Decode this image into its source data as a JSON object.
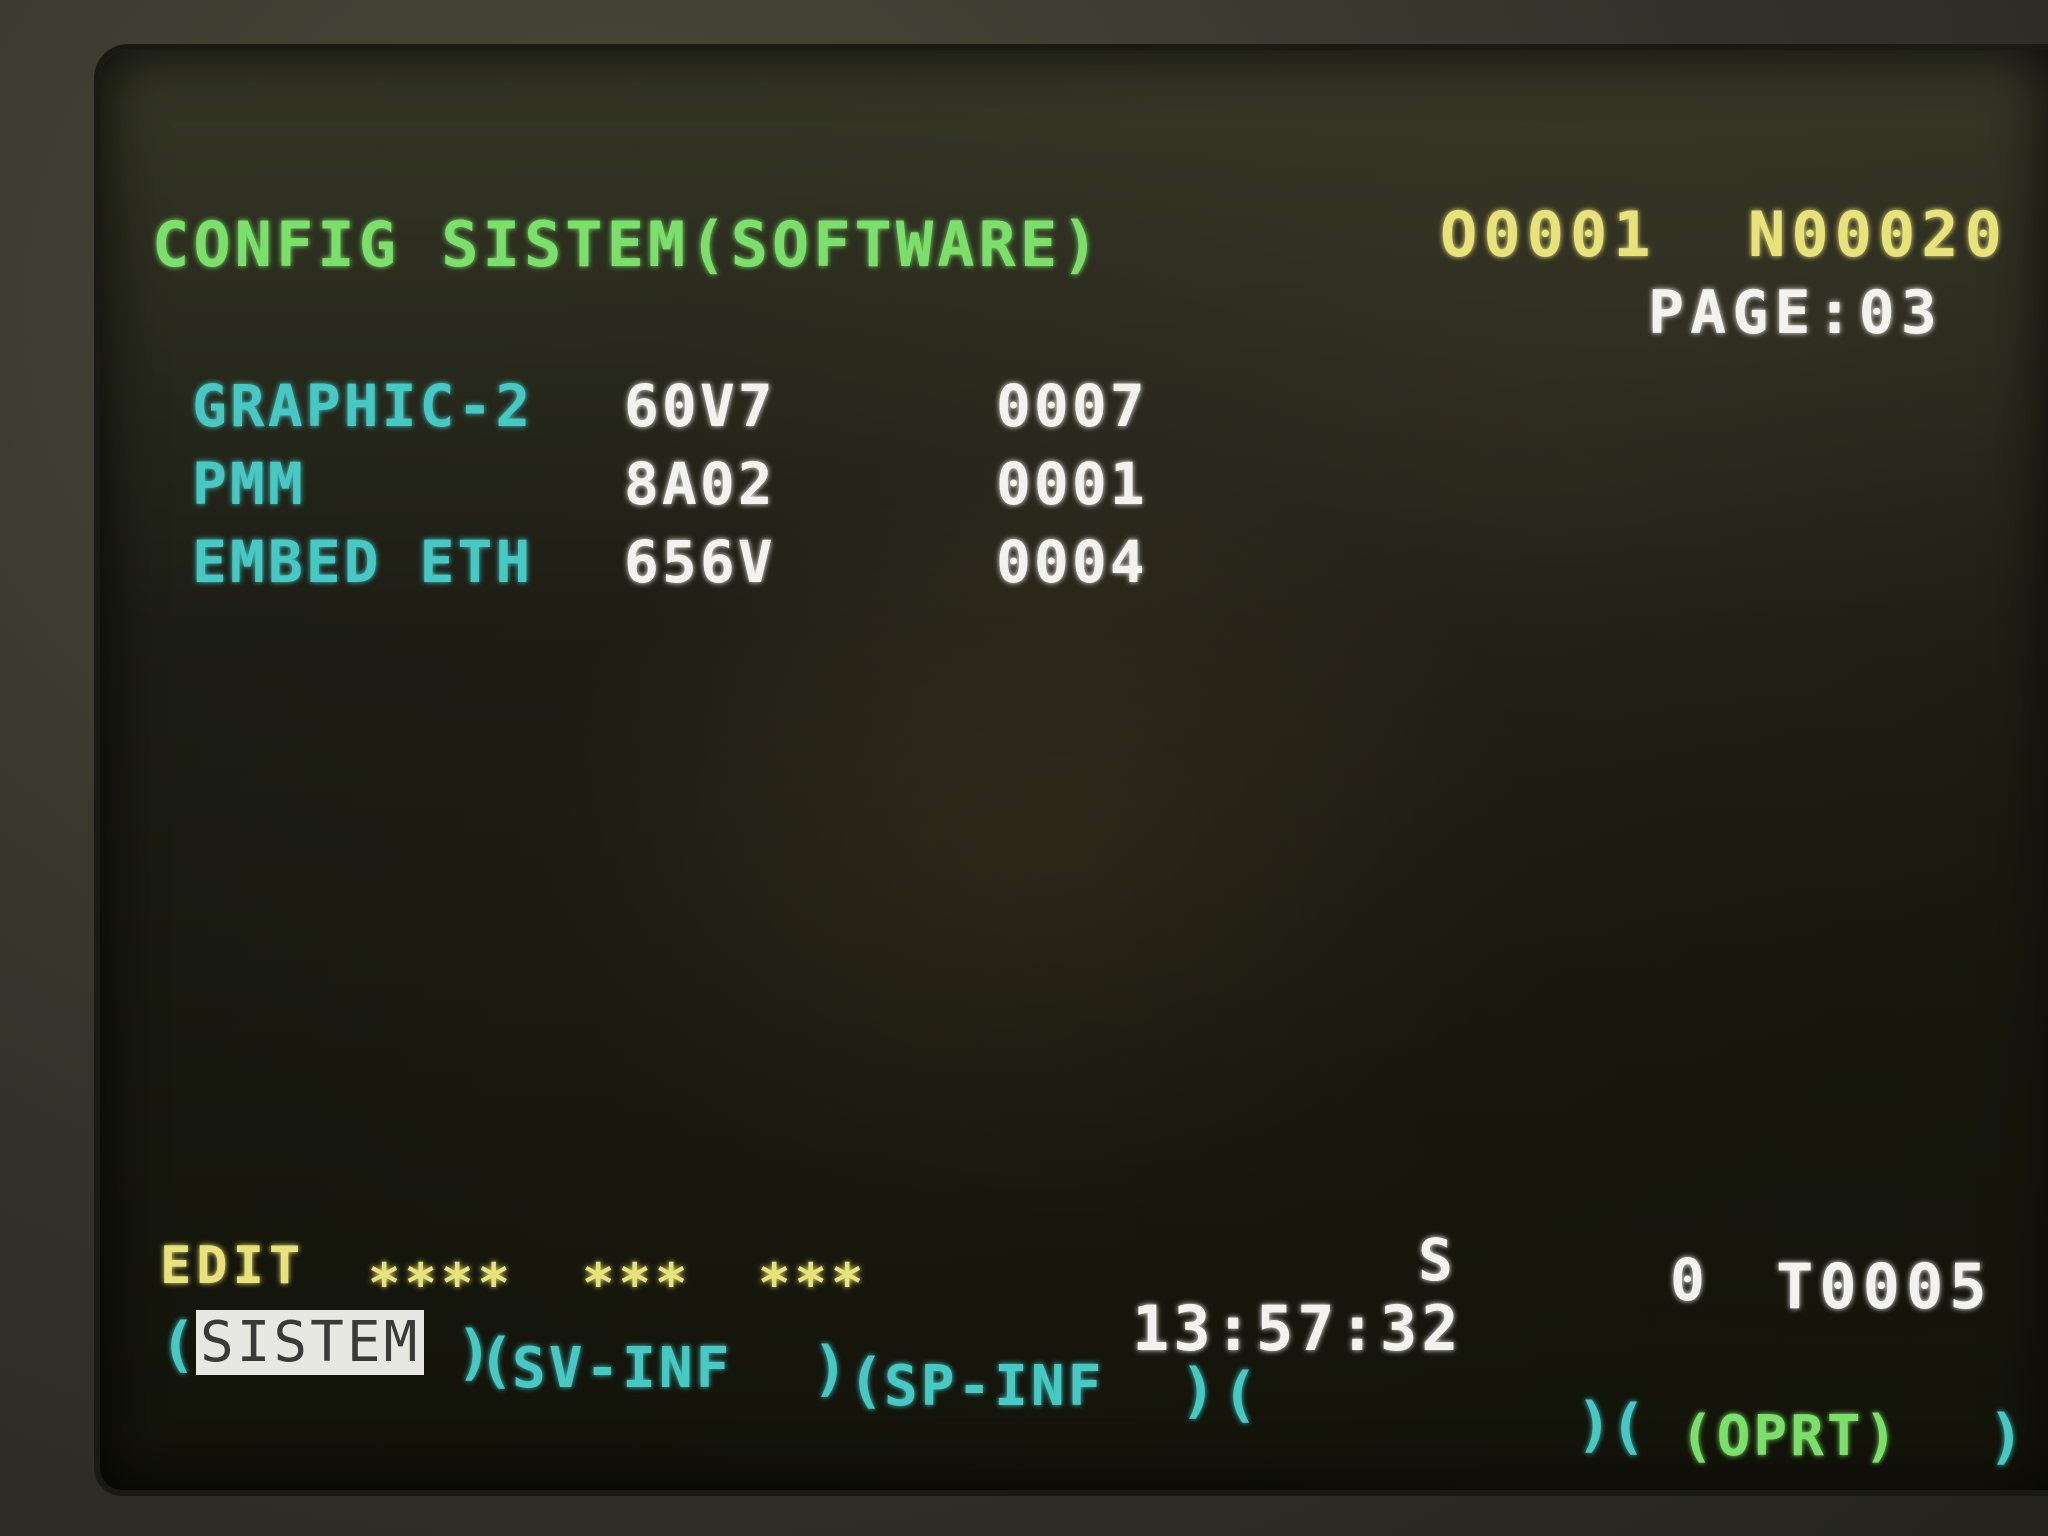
{
  "header": {
    "title": "CONFIG SISTEM(SOFTWARE)",
    "program_number": "O0001",
    "sequence_number": "N00020",
    "page_label": "PAGE:03"
  },
  "software_list": [
    {
      "name": "GRAPHIC-2",
      "series": "60V7",
      "edition": "0007"
    },
    {
      "name": "PMM",
      "series": "8A02",
      "edition": "0001"
    },
    {
      "name": "EMBED ETH",
      "series": "656V",
      "edition": "0004"
    }
  ],
  "status_bar": {
    "mode": "EDIT",
    "stars_1": "****",
    "stars_2": "***",
    "stars_3": "***",
    "spindle_label": "S",
    "spindle_value": "0",
    "tool": "T0005",
    "time": "13:57:32"
  },
  "softkeys": {
    "key1": "SISTEM",
    "key2": "SV-INF",
    "key3": "SP-INF",
    "key4": "",
    "key5": "(OPRT)",
    "open": "(",
    "close": ")"
  },
  "colors": {
    "title_green": "#7be06a",
    "label_cyan": "#46c9c4",
    "value_white": "#f2f2ee",
    "status_yellow": "#e8e27a"
  }
}
